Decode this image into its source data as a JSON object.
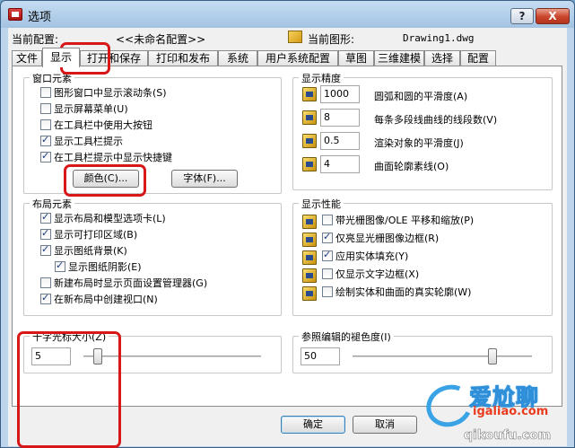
{
  "window": {
    "title": "选项",
    "help": "?",
    "close": "X"
  },
  "header": {
    "config_label": "当前配置:",
    "config_value": "<<未命名配置>>",
    "drawing_label": "当前图形:",
    "drawing_value": "Drawing1.dwg"
  },
  "tabs": [
    "文件",
    "显示",
    "打开和保存",
    "打印和发布",
    "系统",
    "用户系统配置",
    "草图",
    "三维建模",
    "选择",
    "配置"
  ],
  "window_elements": {
    "title": "窗口元素",
    "items": [
      {
        "label": "图形窗口中显示滚动条(S)",
        "checked": false
      },
      {
        "label": "显示屏幕菜单(U)",
        "checked": false
      },
      {
        "label": "在工具栏中使用大按钮",
        "checked": false
      },
      {
        "label": "显示工具栏提示",
        "checked": true
      },
      {
        "label": "在工具栏提示中显示快捷键",
        "checked": true
      }
    ],
    "color_button": "颜色(C)...",
    "font_button": "字体(F)..."
  },
  "layout_elements": {
    "title": "布局元素",
    "items": [
      {
        "label": "显示布局和模型选项卡(L)",
        "checked": true
      },
      {
        "label": "显示可打印区域(B)",
        "checked": true
      },
      {
        "label": "显示图纸背景(K)",
        "checked": true
      },
      {
        "label": "显示图纸阴影(E)",
        "checked": true
      },
      {
        "label": "新建布局时显示页面设置管理器(G)",
        "checked": false
      },
      {
        "label": "在新布局中创建视口(N)",
        "checked": true
      }
    ]
  },
  "crosshair": {
    "title": "十字光标大小(Z)",
    "value": "5",
    "level": 5
  },
  "display_resolution": {
    "title": "显示精度",
    "items": [
      {
        "value": "1000",
        "label": "圆弧和圆的平滑度(A)"
      },
      {
        "value": "8",
        "label": "每条多段线曲线的线段数(V)"
      },
      {
        "value": "0.5",
        "label": "渲染对象的平滑度(J)"
      },
      {
        "value": "4",
        "label": "曲面轮廓素线(O)"
      }
    ]
  },
  "display_performance": {
    "title": "显示性能",
    "items": [
      {
        "label": "带光栅图像/OLE 平移和缩放(P)",
        "checked": false
      },
      {
        "label": "仅亮显光栅图像边框(R)",
        "checked": true
      },
      {
        "label": "应用实体填充(Y)",
        "checked": true
      },
      {
        "label": "仅显示文字边框(X)",
        "checked": false
      },
      {
        "label": "绘制实体和曲面的真实轮廓(W)",
        "checked": false
      }
    ]
  },
  "xref_fading": {
    "title": "参照编辑的褪色度(I)",
    "value": "50",
    "level": 50
  },
  "buttons": {
    "ok": "确定",
    "cancel": "取消"
  },
  "watermark": {
    "text": "爱尬聊",
    "url1": "igaliao.com",
    "url2": "qikoufu.com"
  }
}
